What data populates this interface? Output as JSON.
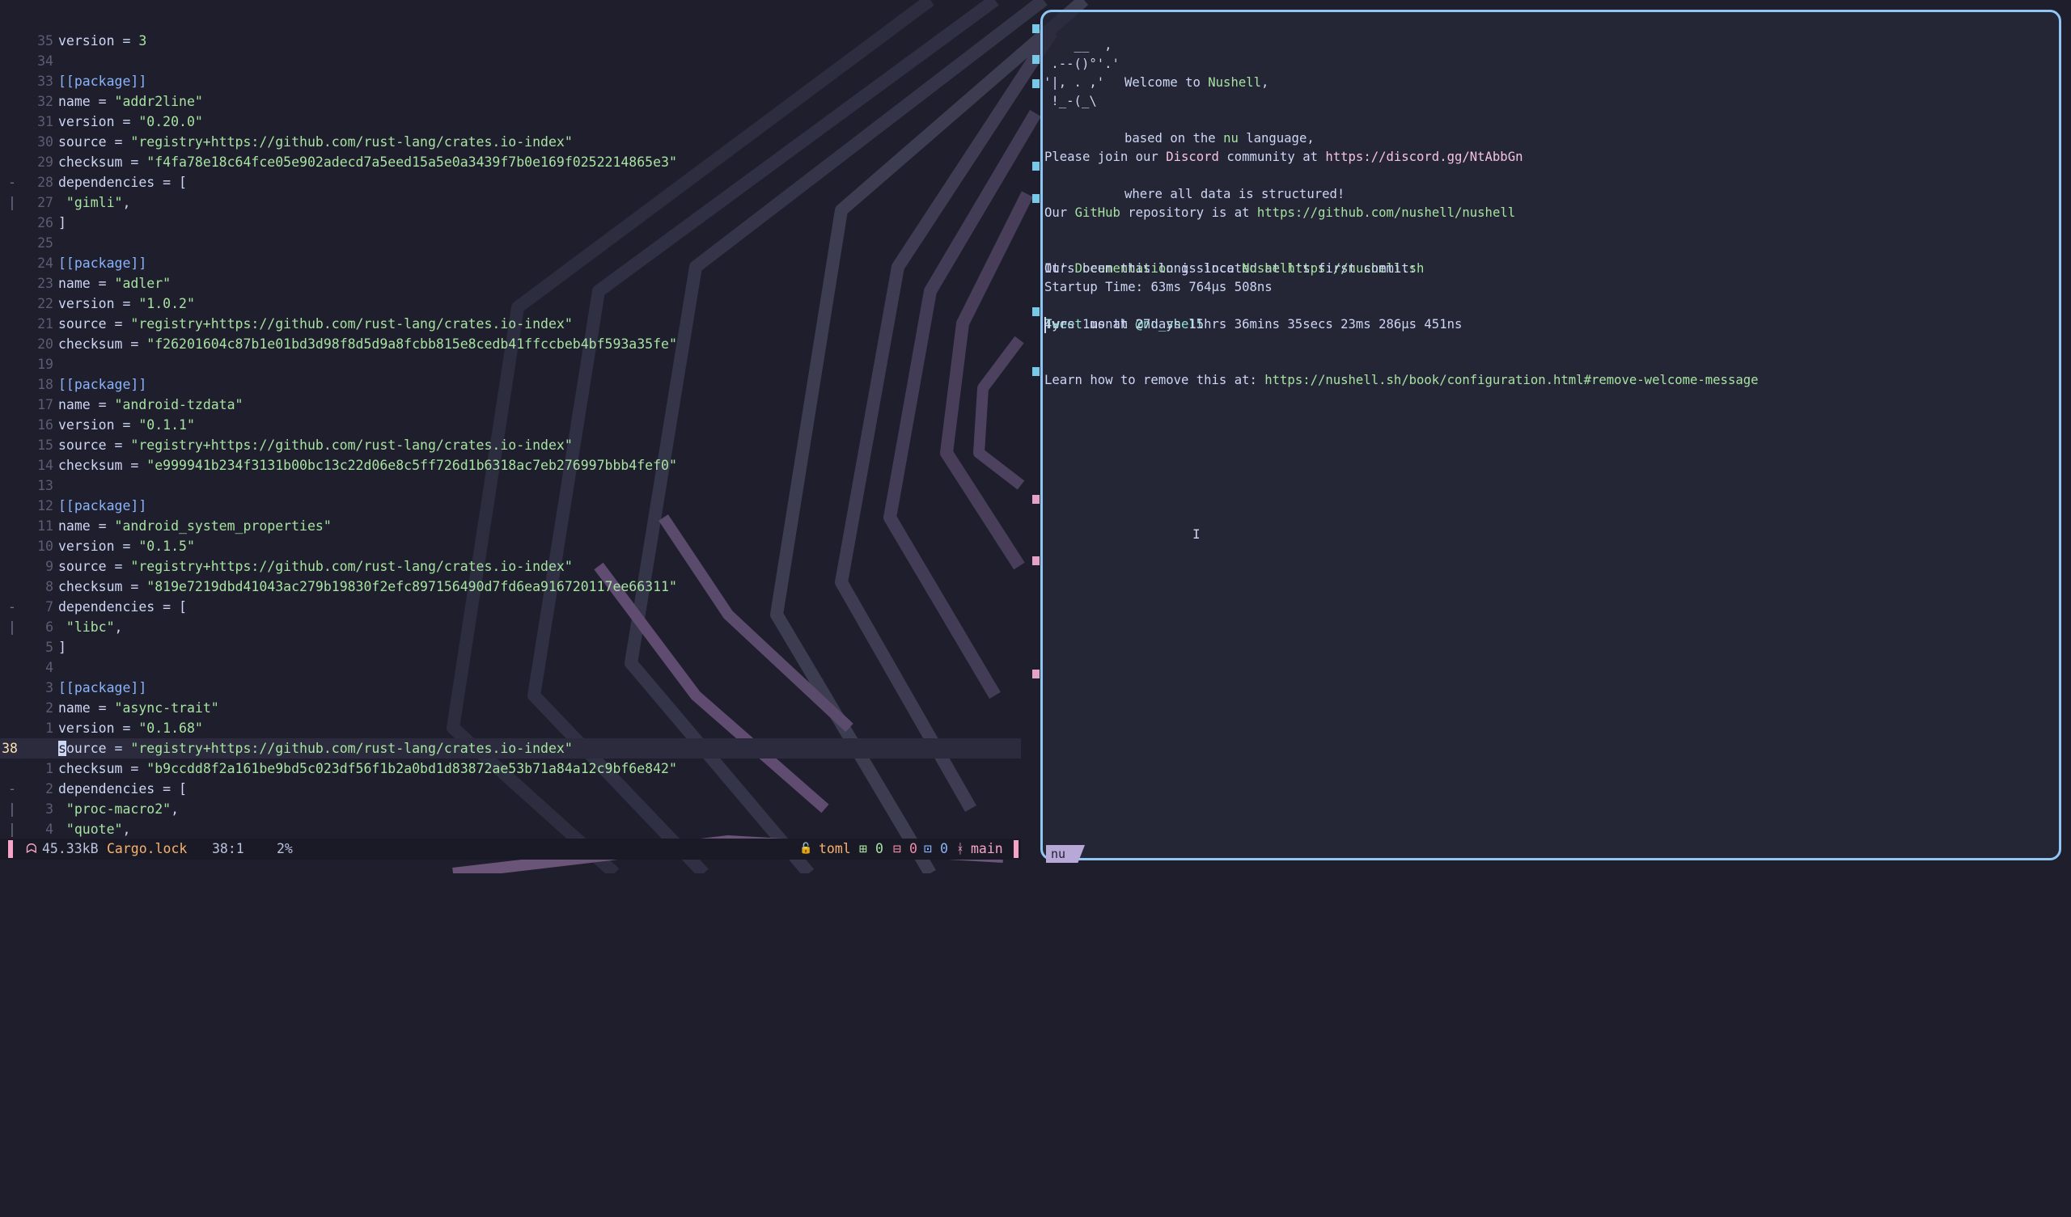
{
  "editor": {
    "lines": [
      {
        "ln": "35",
        "parts": [
          [
            "key",
            "version = "
          ],
          [
            "str",
            "3"
          ]
        ]
      },
      {
        "ln": "34",
        "parts": []
      },
      {
        "ln": "33",
        "parts": [
          [
            "hdr",
            "[[package]]"
          ]
        ]
      },
      {
        "ln": "32",
        "parts": [
          [
            "key",
            "name = "
          ],
          [
            "str",
            "\"addr2line\""
          ]
        ]
      },
      {
        "ln": "31",
        "parts": [
          [
            "key",
            "version = "
          ],
          [
            "str",
            "\"0.20.0\""
          ]
        ]
      },
      {
        "ln": "30",
        "parts": [
          [
            "key",
            "source = "
          ],
          [
            "str",
            "\"registry+https://github.com/rust-lang/crates.io-index\""
          ]
        ]
      },
      {
        "ln": "29",
        "parts": [
          [
            "key",
            "checksum = "
          ],
          [
            "str",
            "\"f4fa78e18c64fce05e902adecd7a5eed15a5e0a3439f7b0e169f0252214865e3\""
          ]
        ]
      },
      {
        "ln": "28",
        "fold": "-",
        "parts": [
          [
            "key",
            "dependencies = ["
          ]
        ]
      },
      {
        "ln": "27",
        "fold": "|",
        "parts": [
          [
            "str",
            " \"gimli\""
          ],
          [
            "key",
            ","
          ]
        ]
      },
      {
        "ln": "26",
        "parts": [
          [
            "key",
            "]"
          ]
        ]
      },
      {
        "ln": "25",
        "parts": []
      },
      {
        "ln": "24",
        "parts": [
          [
            "hdr",
            "[[package]]"
          ]
        ]
      },
      {
        "ln": "23",
        "parts": [
          [
            "key",
            "name = "
          ],
          [
            "str",
            "\"adler\""
          ]
        ]
      },
      {
        "ln": "22",
        "parts": [
          [
            "key",
            "version = "
          ],
          [
            "str",
            "\"1.0.2\""
          ]
        ]
      },
      {
        "ln": "21",
        "parts": [
          [
            "key",
            "source = "
          ],
          [
            "str",
            "\"registry+https://github.com/rust-lang/crates.io-index\""
          ]
        ]
      },
      {
        "ln": "20",
        "parts": [
          [
            "key",
            "checksum = "
          ],
          [
            "str",
            "\"f26201604c87b1e01bd3d98f8d5d9a8fcbb815e8cedb41ffccbeb4bf593a35fe\""
          ]
        ]
      },
      {
        "ln": "19",
        "parts": []
      },
      {
        "ln": "18",
        "parts": [
          [
            "hdr",
            "[[package]]"
          ]
        ]
      },
      {
        "ln": "17",
        "parts": [
          [
            "key",
            "name = "
          ],
          [
            "str",
            "\"android-tzdata\""
          ]
        ]
      },
      {
        "ln": "16",
        "parts": [
          [
            "key",
            "version = "
          ],
          [
            "str",
            "\"0.1.1\""
          ]
        ]
      },
      {
        "ln": "15",
        "parts": [
          [
            "key",
            "source = "
          ],
          [
            "str",
            "\"registry+https://github.com/rust-lang/crates.io-index\""
          ]
        ]
      },
      {
        "ln": "14",
        "parts": [
          [
            "key",
            "checksum = "
          ],
          [
            "str",
            "\"e999941b234f3131b00bc13c22d06e8c5ff726d1b6318ac7eb276997bbb4fef0\""
          ]
        ]
      },
      {
        "ln": "13",
        "parts": []
      },
      {
        "ln": "12",
        "parts": [
          [
            "hdr",
            "[[package]]"
          ]
        ]
      },
      {
        "ln": "11",
        "parts": [
          [
            "key",
            "name = "
          ],
          [
            "str",
            "\"android_system_properties\""
          ]
        ]
      },
      {
        "ln": "10",
        "parts": [
          [
            "key",
            "version = "
          ],
          [
            "str",
            "\"0.1.5\""
          ]
        ]
      },
      {
        "ln": "9",
        "parts": [
          [
            "key",
            "source = "
          ],
          [
            "str",
            "\"registry+https://github.com/rust-lang/crates.io-index\""
          ]
        ]
      },
      {
        "ln": "8",
        "parts": [
          [
            "key",
            "checksum = "
          ],
          [
            "str",
            "\"819e7219dbd41043ac279b19830f2efc897156490d7fd6ea916720117ee66311\""
          ]
        ]
      },
      {
        "ln": "7",
        "fold": "-",
        "parts": [
          [
            "key",
            "dependencies = ["
          ]
        ]
      },
      {
        "ln": "6",
        "fold": "|",
        "parts": [
          [
            "str",
            " \"libc\""
          ],
          [
            "key",
            ","
          ]
        ]
      },
      {
        "ln": "5",
        "parts": [
          [
            "key",
            "]"
          ]
        ]
      },
      {
        "ln": "4",
        "parts": []
      },
      {
        "ln": "3",
        "parts": [
          [
            "hdr",
            "[[package]]"
          ]
        ]
      },
      {
        "ln": "2",
        "parts": [
          [
            "key",
            "name = "
          ],
          [
            "str",
            "\"async-trait\""
          ]
        ]
      },
      {
        "ln": "1",
        "parts": [
          [
            "key",
            "version = "
          ],
          [
            "str",
            "\"0.1.68\""
          ]
        ]
      },
      {
        "ln": "38",
        "current": true,
        "parts": [
          [
            "cursor",
            "s"
          ],
          [
            "key",
            "ource = "
          ],
          [
            "str",
            "\"registry+https://github.com/rust-lang/crates.io-index\""
          ]
        ]
      },
      {
        "ln": "1",
        "parts": [
          [
            "key",
            "checksum = "
          ],
          [
            "str",
            "\"b9ccdd8f2a161be9bd5c023df56f1b2a0bd1d83872ae53b71a84a12c9bf6e842\""
          ]
        ]
      },
      {
        "ln": "2",
        "fold": "-",
        "parts": [
          [
            "key",
            "dependencies = ["
          ]
        ]
      },
      {
        "ln": "3",
        "fold": "|",
        "parts": [
          [
            "str",
            " \"proc-macro2\""
          ],
          [
            "key",
            ","
          ]
        ]
      },
      {
        "ln": "4",
        "fold": "|",
        "parts": [
          [
            "str",
            " \"quote\""
          ],
          [
            "key",
            ","
          ]
        ]
      }
    ]
  },
  "status": {
    "mode_icon": "ᗣ",
    "size": "45.33kB",
    "file": "Cargo.lock",
    "position": "38:1",
    "percent": "2%",
    "lock_icon": "🔓",
    "filetype": "toml",
    "added": "0",
    "removed": "0",
    "changed": "0",
    "branch_icon": "ᚼ",
    "branch": "main"
  },
  "terminal": {
    "logo": [
      "    __  ,",
      " .--()°'.'",
      "'|, . ,'",
      " !_-(_\\"
    ],
    "welcome": [
      "Welcome to ",
      "Nushell",
      ","
    ],
    "based": [
      "based on the ",
      "nu",
      " language,"
    ],
    "where": "where all data is structured!",
    "discord": [
      "Please join our ",
      "Discord",
      " community at ",
      "https://discord.gg/NtAbbGn"
    ],
    "github": [
      "Our ",
      "GitHub",
      " repository is at ",
      "https://github.com/nushell/nushell"
    ],
    "docs": [
      "Our ",
      "Documentation",
      " is located at ",
      "https://nushell.sh"
    ],
    "tweet": [
      "Tweet",
      " us at ",
      "@nu_shell"
    ],
    "remove": [
      "Learn how to remove this at: ",
      "https://nushell.sh/book/configuration.html#remove-welcome-message"
    ],
    "since": [
      "It's been this long since ",
      "Nushell",
      "'s first commit:"
    ],
    "age": "4yrs 1month 27days 15hrs 36mins 35secs 23ms 286µs 451ns",
    "startup": [
      "Startup Time: ",
      "63ms 764µs 508ns"
    ],
    "tab_label": "nu"
  },
  "colors": {
    "background": "#1f1e2c",
    "terminal_border": "#8fc6f3",
    "string_green": "#a6e3a1",
    "header_blue": "#89b4fa",
    "accent_pink": "#f5a3c7"
  }
}
